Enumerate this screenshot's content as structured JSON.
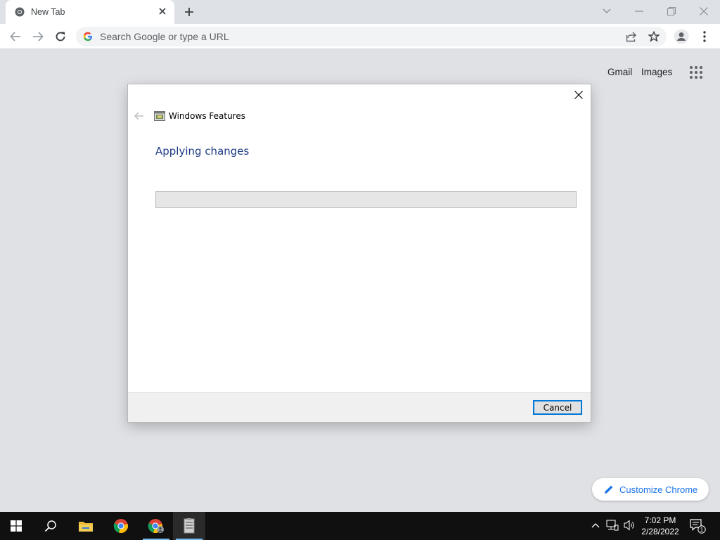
{
  "browser": {
    "tab": {
      "title": "New Tab"
    },
    "omnibox": {
      "placeholder": "Search Google or type a URL"
    },
    "ntp": {
      "gmail": "Gmail",
      "images": "Images",
      "customize_label": "Customize Chrome"
    }
  },
  "dialog": {
    "window_title": "Windows Features",
    "heading": "Applying changes",
    "progress": 0,
    "cancel_label": "Cancel"
  },
  "taskbar": {
    "time": "7:02 PM",
    "date": "2/28/2022",
    "notification_count": "1"
  },
  "colors": {
    "accent_blue": "#1a73e8",
    "dialog_heading": "#1f3b84",
    "focus_border": "#0078d7",
    "taskbar": "#101010"
  },
  "icons": [
    "chrome-icon",
    "close-icon",
    "plus-icon",
    "chevron-down-icon",
    "minimize-icon",
    "restore-icon",
    "back-arrow-icon",
    "forward-arrow-icon",
    "reload-icon",
    "google-g-icon",
    "share-icon",
    "star-icon",
    "profile-icon",
    "kebab-menu-icon",
    "apps-grid-icon",
    "windows-features-icon",
    "pencil-icon",
    "windows-start-icon",
    "search-icon",
    "file-explorer-icon",
    "chrome-taskbar-icon",
    "chrome-profile-taskbar-icon",
    "windows-features-taskbar-icon",
    "chevron-up-icon",
    "network-icon",
    "volume-icon",
    "notification-icon"
  ]
}
